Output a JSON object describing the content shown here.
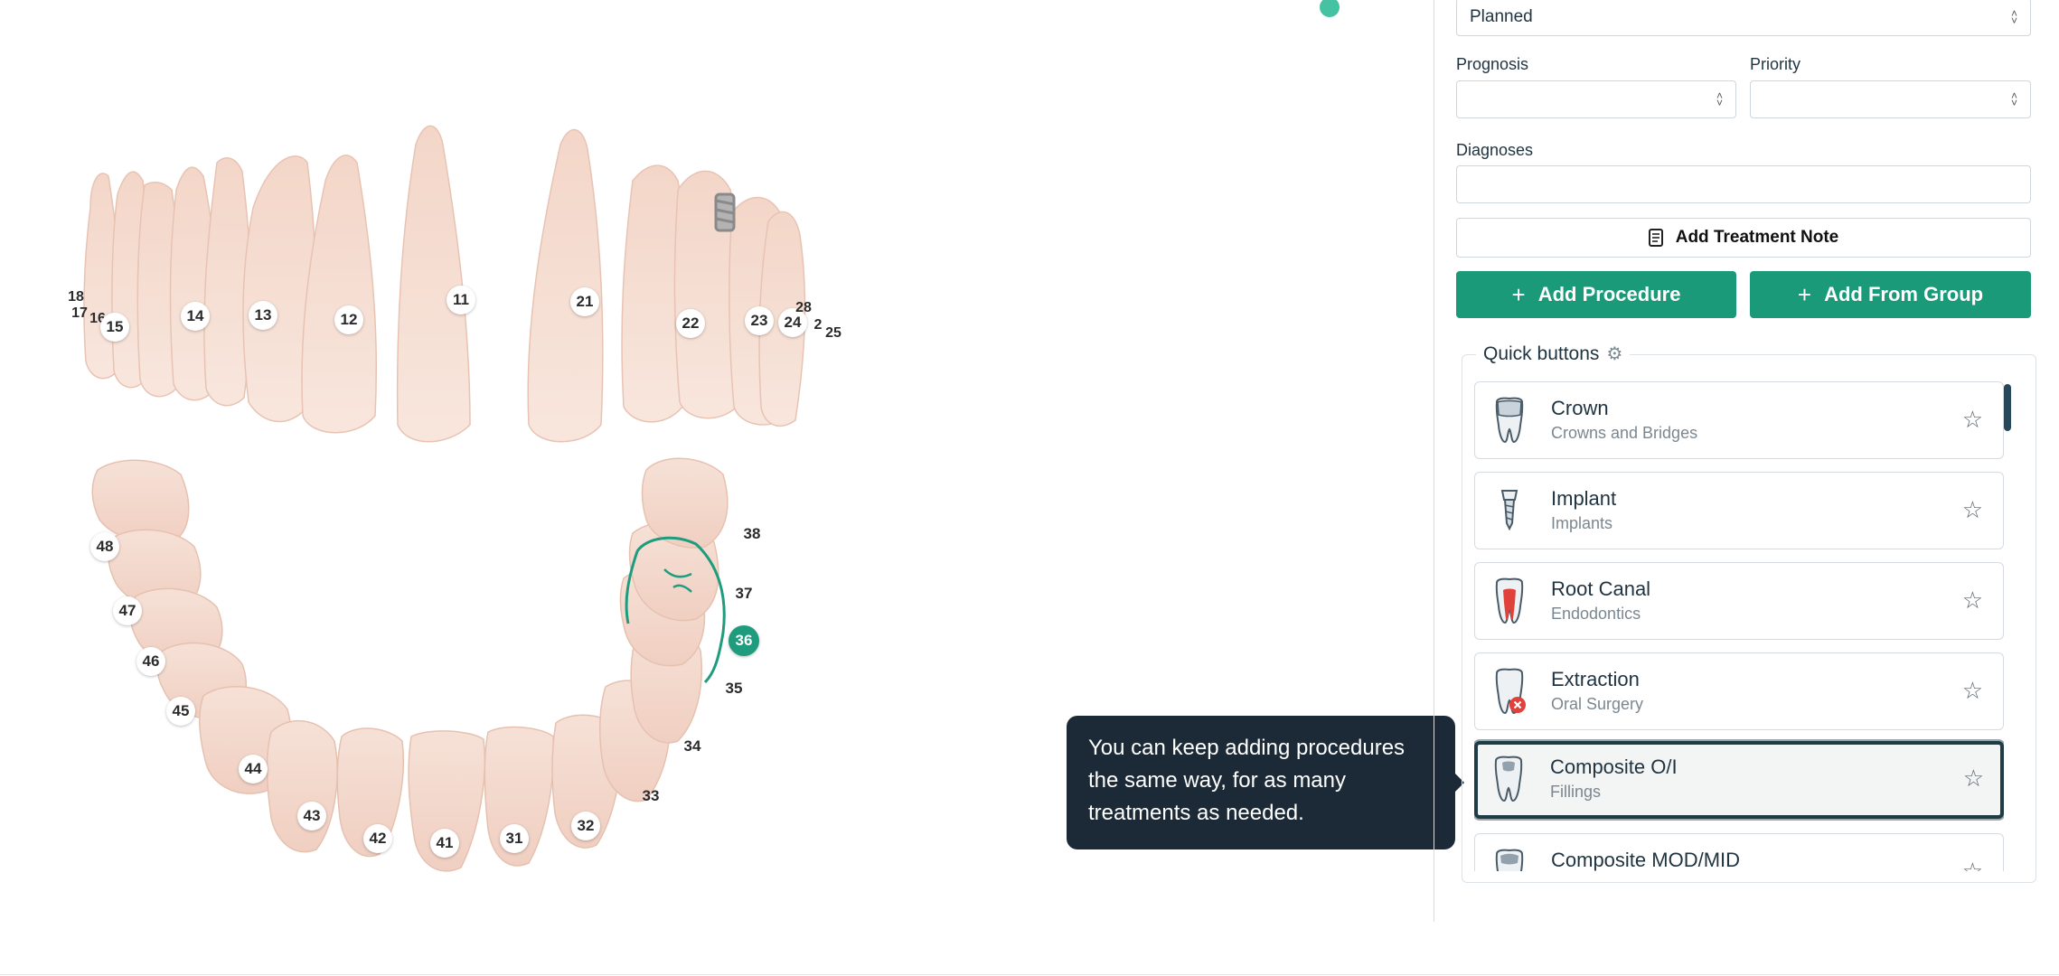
{
  "status_select": {
    "value": "Planned"
  },
  "prognosis": {
    "label": "Prognosis",
    "value": ""
  },
  "priority": {
    "label": "Priority",
    "value": ""
  },
  "diagnoses": {
    "label": "Diagnoses",
    "value": ""
  },
  "treatment_note_button": {
    "label": "Add Treatment Note",
    "icon": "note-icon"
  },
  "add_procedure_button": {
    "label": "Add Procedure",
    "icon": "plus-icon"
  },
  "add_from_group_button": {
    "label": "Add From Group",
    "icon": "plus-icon"
  },
  "quick_buttons": {
    "title": "Quick buttons",
    "items": [
      {
        "name": "Crown",
        "category": "Crowns and Bridges",
        "icon": "crown-tooth-icon"
      },
      {
        "name": "Implant",
        "category": "Implants",
        "icon": "implant-icon"
      },
      {
        "name": "Root Canal",
        "category": "Endodontics",
        "icon": "root-canal-icon"
      },
      {
        "name": "Extraction",
        "category": "Oral Surgery",
        "icon": "extraction-icon"
      },
      {
        "name": "Composite O/I",
        "category": "Fillings",
        "icon": "filling-icon"
      },
      {
        "name": "Composite MOD/MID",
        "category": "",
        "icon": "filling-icon"
      }
    ]
  },
  "tooltip": {
    "text": "You can keep adding procedures the same way, for as many treatments as needed."
  },
  "tooth_chart": {
    "selected_tooth": "36",
    "upper_labels": [
      "18",
      "17",
      "16",
      "15",
      "14",
      "13",
      "12",
      "11",
      "21",
      "22",
      "23",
      "24",
      "28",
      "2",
      "25"
    ],
    "lower_labels": [
      "48",
      "47",
      "46",
      "45",
      "44",
      "43",
      "42",
      "41",
      "31",
      "32",
      "33",
      "34",
      "35",
      "36",
      "37",
      "38"
    ]
  },
  "colors": {
    "accent": "#1a9a79",
    "tooltip_bg": "#1b2a36",
    "selected_tooth": "#1e9c7d"
  }
}
